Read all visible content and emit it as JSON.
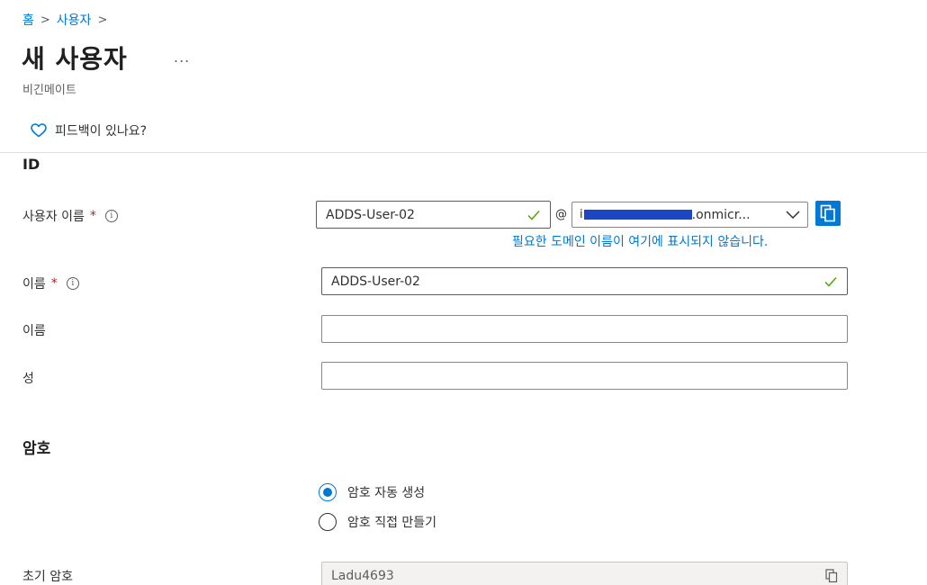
{
  "breadcrumb": {
    "home": "홈",
    "users": "사용자",
    "separator": ">"
  },
  "page": {
    "title": "새 사용자",
    "more": "...",
    "subtitle": "비긴메이트"
  },
  "feedback": {
    "label": "피드백이 있나요?",
    "icon": "heart-icon"
  },
  "identity": {
    "section_title": "ID",
    "username": {
      "label": "사용자 이름",
      "required_mark": "*",
      "value": "ADDS-User-02",
      "at": "@",
      "domain_visible_text": ".onmicr...",
      "domain_hint": "필요한 도메인 이름이 여기에 표시되지 않습니다."
    },
    "name": {
      "label": "이름",
      "required_mark": "*",
      "value": "ADDS-User-02"
    },
    "first_name": {
      "label": "이름",
      "value": ""
    },
    "last_name": {
      "label": "성",
      "value": ""
    }
  },
  "password": {
    "section_title": "암호",
    "options": [
      {
        "label": "암호 자동 생성",
        "checked": true
      },
      {
        "label": "암호 직접 만들기",
        "checked": false
      }
    ],
    "initial": {
      "label": "초기 암호",
      "value": "Ladu4693"
    }
  },
  "colors": {
    "accent": "#0078d4",
    "valid_border": "#8a2be2",
    "check": "#57a300",
    "required": "#a4262c"
  }
}
